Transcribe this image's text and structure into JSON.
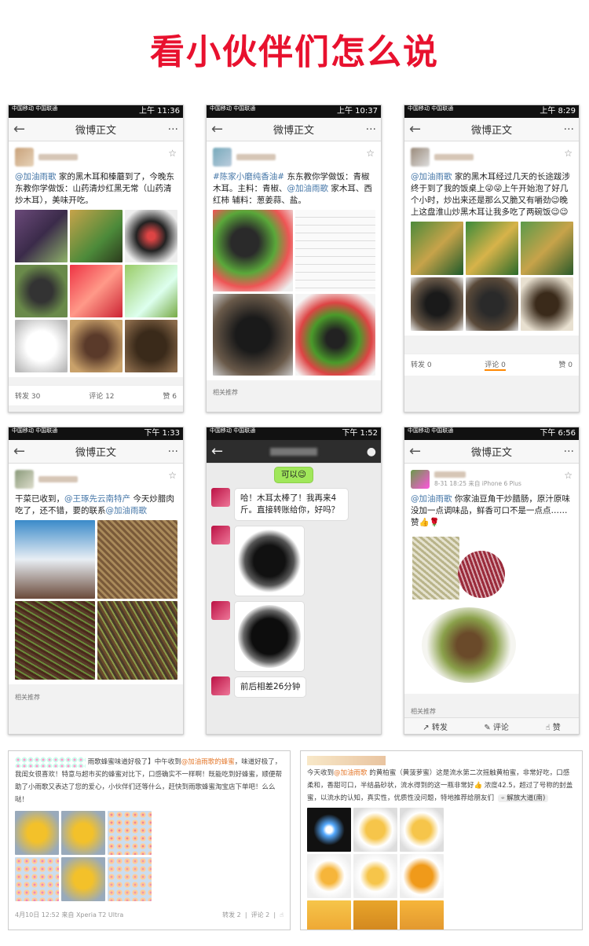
{
  "page_title": "看小伙伴们怎么说",
  "phone1": {
    "status_time": "上午 11:36",
    "carrier": "中国移动\n中国联通",
    "nav_title": "微博正文",
    "back_icon": "arrow-left-icon",
    "more_icon": "more-dots-icon",
    "mention": "@加油雨歌",
    "text": " 家的黑木耳和榛蘑到了，今晚东东教你学做饭：山药清炒红黑无常（山药清炒木耳），美味开吃。",
    "repost": "转发 30",
    "comment": "评论 12",
    "like": "赞 6"
  },
  "phone2": {
    "status_time": "上午 10:37",
    "carrier": "中国移动\n中国联通",
    "nav_title": "微博正文",
    "hashtag": "#陈家小磨纯香油#",
    "text1": " 东东教你学做饭：青椒木耳。主料：青椒、",
    "mention": "@加油雨歌",
    "text2": " 家木耳、西红柿 辅料：葱姜蒜、盐。",
    "related": "相关推荐"
  },
  "phone3": {
    "status_time": "上午 8:29",
    "carrier": "中国移动\n中国联通",
    "nav_title": "微博正文",
    "mention": "@加油雨歌",
    "text": " 家的黑木耳经过几天的长途跋涉终于到了我的饭桌上😜😜上午开始泡了好几个小时，炒出来还是那么又脆又有嚼劲😉晚上这盘淮山炒黑木耳让我多吃了两碗饭😉😉",
    "repost": "转发 0",
    "comment": "评论 0",
    "like": "赞 0"
  },
  "phone4": {
    "status_time": "下午 1:33",
    "carrier": "中国移动\n中国联通",
    "nav_title": "微博正文",
    "text1": "干菜已收到，",
    "mention1": "@王琢先云南特产",
    "text2": " 今天炒腊肉吃了，还不错，要的联系",
    "mention2": "@加油雨歌",
    "related": "相关推荐"
  },
  "phone5": {
    "status_time": "下午 1:52",
    "carrier": "中国移动\n中国联通",
    "top_bubble": "可以😉",
    "msg1": "哈！木耳太棒了！我再来4斤。直接转账给你，好吗？",
    "msg2": "前后相差26分钟"
  },
  "phone6": {
    "status_time": "下午 6:56",
    "carrier": "中国移动\n中国联通",
    "nav_title": "微博正文",
    "meta": "8-31 18:25  来自 iPhone 6 Plus",
    "mention": "@加油雨歌",
    "text": " 你家油豆角干炒腊肠，原汁原味没加一点调味品，鲜香可口不是一点点……赞👍🌹",
    "related": "相关推荐",
    "repost": "转发",
    "comment": "评论",
    "like": "赞"
  },
  "shot1": {
    "text_a": "雨歌蜂蜜味道好极了】中午收到",
    "mention": "@加油雨歌的蜂蜜",
    "text_b": "，味道好极了，我闺女很喜欢！特意与超市买的蜂蜜对比下，口感确实不一样啊！既能吃到好蜂蜜，顺便帮助了小雨歌又表达了您的爱心，小伙伴们还等什么，赶快到雨歌蜂蜜淘宝店下单吧！么么哒！",
    "meta": "4月10日 12:52 来自 Xperia T2 Ultra",
    "repost": "转发 2",
    "comment": "评论 2"
  },
  "shot2": {
    "text_a": "今天收到",
    "mention": "@加油雨歌",
    "text_b": " 的黄柏蜜（黄菠萝蜜）这是流水第二次摇触黄柏蜜，非常好吃，口感柔和，香甜可口，半结晶砂状，流水得到的这一瓶非常好👍 浓度42.5，超过了号称的封盖蜜，以流水的认知，真实性，优质性没问题，特地推荐给朋友们",
    "location": "解放大道(南)"
  }
}
